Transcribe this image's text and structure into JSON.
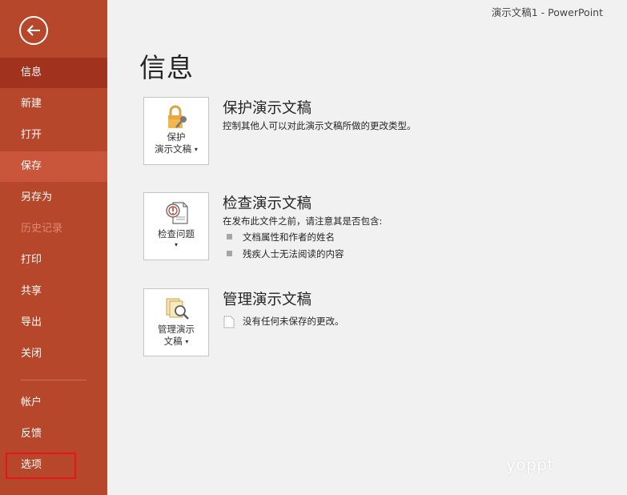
{
  "window": {
    "title": "演示文稿1  -  PowerPoint"
  },
  "sidebar": {
    "items": [
      {
        "label": "信息",
        "state": "selected"
      },
      {
        "label": "新建",
        "state": "normal"
      },
      {
        "label": "打开",
        "state": "normal"
      },
      {
        "label": "保存",
        "state": "hover"
      },
      {
        "label": "另存为",
        "state": "normal"
      },
      {
        "label": "历史记录",
        "state": "disabled"
      },
      {
        "label": "打印",
        "state": "normal"
      },
      {
        "label": "共享",
        "state": "normal"
      },
      {
        "label": "导出",
        "state": "normal"
      },
      {
        "label": "关闭",
        "state": "normal"
      }
    ],
    "bottom_items": [
      {
        "label": "帐户"
      },
      {
        "label": "反馈"
      },
      {
        "label": "选项"
      }
    ],
    "colors": {
      "background": "#b7472a",
      "selected": "#a1331e",
      "highlight": "#e8141b"
    }
  },
  "main": {
    "title": "信息",
    "sections": [
      {
        "tile_line1": "保护",
        "tile_line2": "演示文稿",
        "title": "保护演示文稿",
        "description": "控制其他人可以对此演示文稿所做的更改类型。",
        "icon": "lock-key-icon"
      },
      {
        "tile_line1": "检查问题",
        "title": "检查演示文稿",
        "description": "在发布此文件之前，请注意其是否包含:",
        "bullets": [
          "文档属性和作者的姓名",
          "残疾人士无法阅读的内容"
        ],
        "icon": "inspect-document-icon"
      },
      {
        "tile_line1": "管理演示",
        "tile_line2": "文稿",
        "title": "管理演示文稿",
        "description": "没有任何未保存的更改。",
        "icon": "manage-documents-icon"
      }
    ]
  },
  "watermark": "yoppt"
}
